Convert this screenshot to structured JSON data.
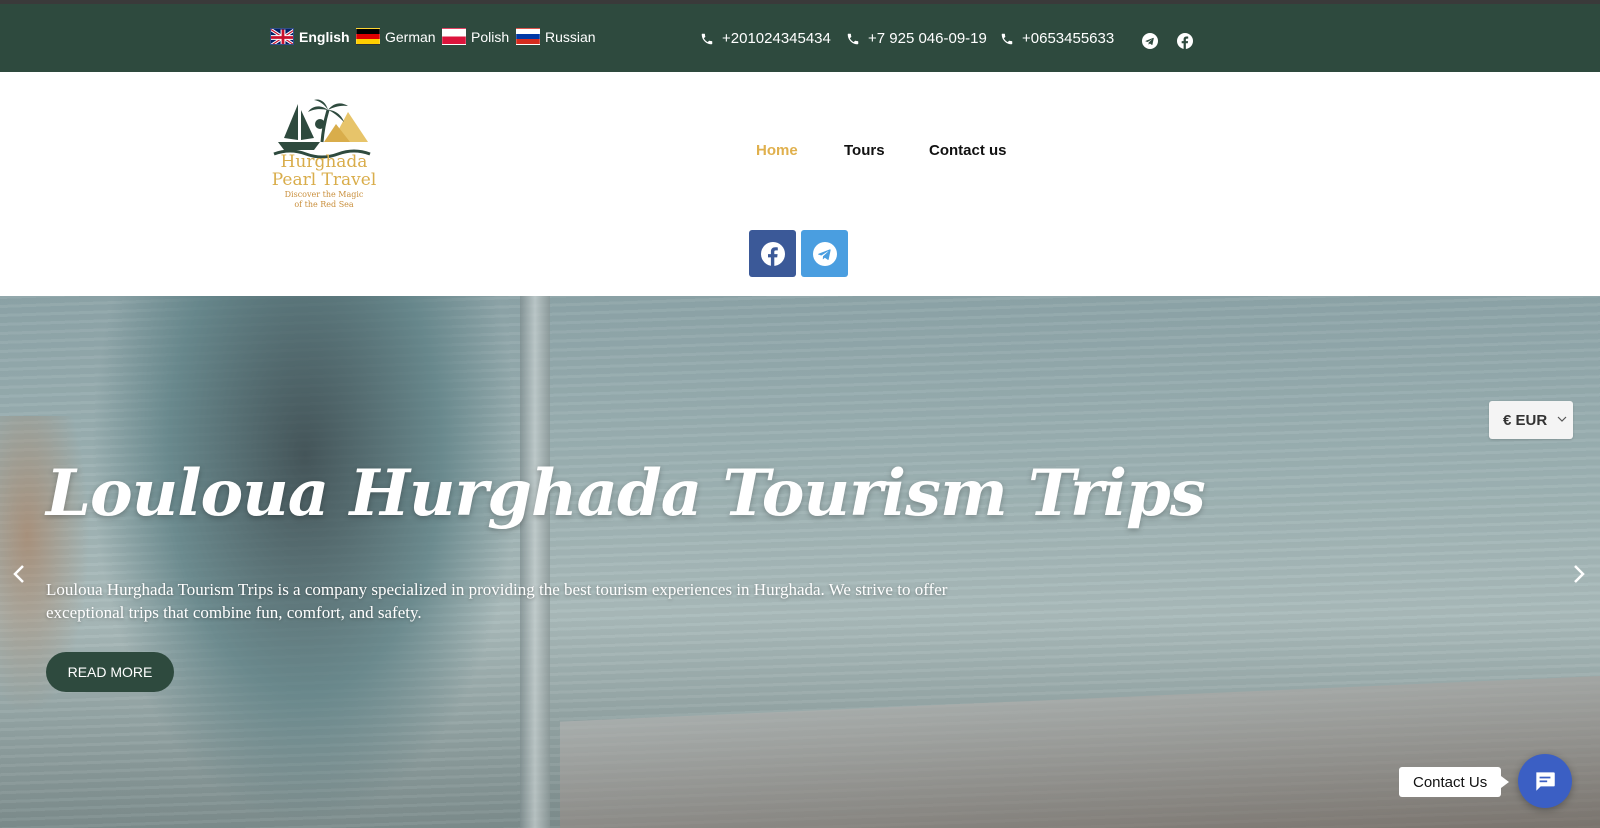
{
  "topbar": {
    "languages": [
      {
        "label": "English",
        "flag": "uk-flag-icon",
        "active": true
      },
      {
        "label": "German",
        "flag": "germany-flag-icon",
        "active": false
      },
      {
        "label": "Polish",
        "flag": "poland-flag-icon",
        "active": false
      },
      {
        "label": "Russian",
        "flag": "russia-flag-icon",
        "active": false
      }
    ],
    "phones": [
      "+201024345434",
      "+7 925 046-09-19",
      "+0653455633"
    ],
    "social_icons": [
      "telegram-icon",
      "facebook-icon"
    ],
    "background_color": "#2e4a3e"
  },
  "header": {
    "logo": {
      "line1": "Hurghada",
      "line2": "Pearl Travel",
      "tagline1": "Discover the Magic",
      "tagline2": "of the Red Sea"
    },
    "nav": [
      {
        "label": "Home",
        "active": true
      },
      {
        "label": "Tours",
        "active": false
      },
      {
        "label": "Contact us",
        "active": false
      }
    ],
    "social_buttons": [
      "facebook-icon",
      "telegram-icon"
    ],
    "accent_color": "#e0b04d"
  },
  "hero": {
    "title": "Louloua Hurghada Tourism Trips",
    "description": "Louloua Hurghada Tourism Trips is a company specialized in providing the best tourism experiences in Hurghada. We strive to offer exceptional trips that combine fun, comfort, and safety.",
    "button_label": "READ MORE"
  },
  "currency": {
    "selected": "€ EUR"
  },
  "chat": {
    "label": "Contact Us",
    "button_color": "#3b5fc4"
  }
}
